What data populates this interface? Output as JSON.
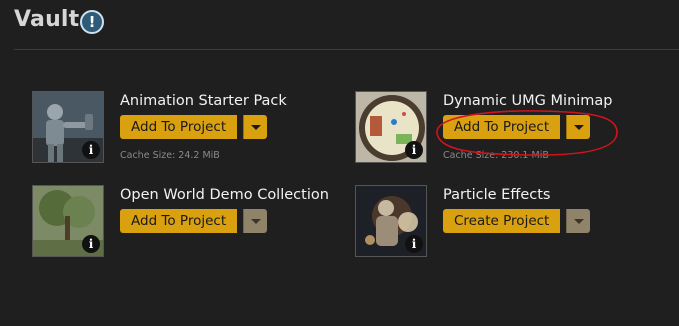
{
  "header": {
    "title": "Vault",
    "alert_icon": "!"
  },
  "items": [
    {
      "title": "Animation Starter Pack",
      "button": "Add To Project",
      "dropdown_enabled": true,
      "cache": "Cache Size: 24.2 MiB",
      "info": "i",
      "thumb_icon": "robot-character-thumbnail"
    },
    {
      "title": "Dynamic UMG Minimap",
      "button": "Add To Project",
      "dropdown_enabled": true,
      "cache": "Cache Size: 230.1 MiB",
      "info": "i",
      "thumb_icon": "minimap-thumbnail"
    },
    {
      "title": "Open World Demo Collection",
      "button": "Add To Project",
      "dropdown_enabled": false,
      "info": "i",
      "thumb_icon": "forest-thumbnail"
    },
    {
      "title": "Particle Effects",
      "button": "Create Project",
      "dropdown_enabled": false,
      "info": "i",
      "thumb_icon": "particle-thumbnail"
    }
  ],
  "colors": {
    "accent": "#d9a010",
    "disabled": "#8f8469",
    "annotation": "#d0141a"
  }
}
